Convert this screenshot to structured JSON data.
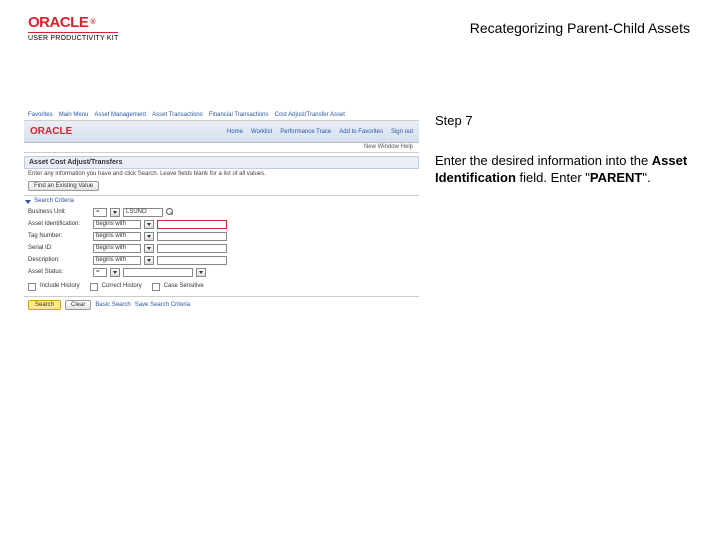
{
  "header": {
    "brand": "ORACLE",
    "reg": "®",
    "subline": "USER PRODUCTIVITY KIT",
    "title": "Recategorizing Parent-Child Assets"
  },
  "instruction": {
    "step_label": "Step 7",
    "line1": "Enter the desired information into the ",
    "bold_field": "Asset Identification",
    "line1_tail": " field. Enter \"",
    "value": "PARENT",
    "line1_end": "\"."
  },
  "shot": {
    "crumb_items": [
      "Favorites",
      "Main Menu",
      "Asset Management",
      "Asset Transactions",
      "Financial Transactions",
      "Cost Adjust/Transfer Asset"
    ],
    "brand": "ORACLE",
    "bar_links": [
      "Home",
      "Worklist",
      "Performance Trace",
      "Add to Favorites",
      "Sign out"
    ],
    "subbar": "New Window  Help",
    "panel_title": "Asset Cost Adjust/Transfers",
    "panel_desc": "Enter any information you have and click Search. Leave fields blank for a list of all values.",
    "find_btn": "Find an Existing Value",
    "section": "Search Criteria",
    "fields": {
      "bu_label": "Business Unit:",
      "bu_value": "LSUNO",
      "aid_label": "Asset Identification:",
      "aid_value": "",
      "tag_label": "Tag Number:",
      "ser_label": "Serial ID:",
      "desc_label": "Description:",
      "stat_label": "Asset Status:",
      "cs_label": "Case Sensitive"
    },
    "inc_hist": "Include History",
    "corr_hist": "Correct History",
    "footer": {
      "search": "Search",
      "clear": "Clear",
      "basic": "Basic Search",
      "save_crit": "Save Search Criteria"
    }
  }
}
